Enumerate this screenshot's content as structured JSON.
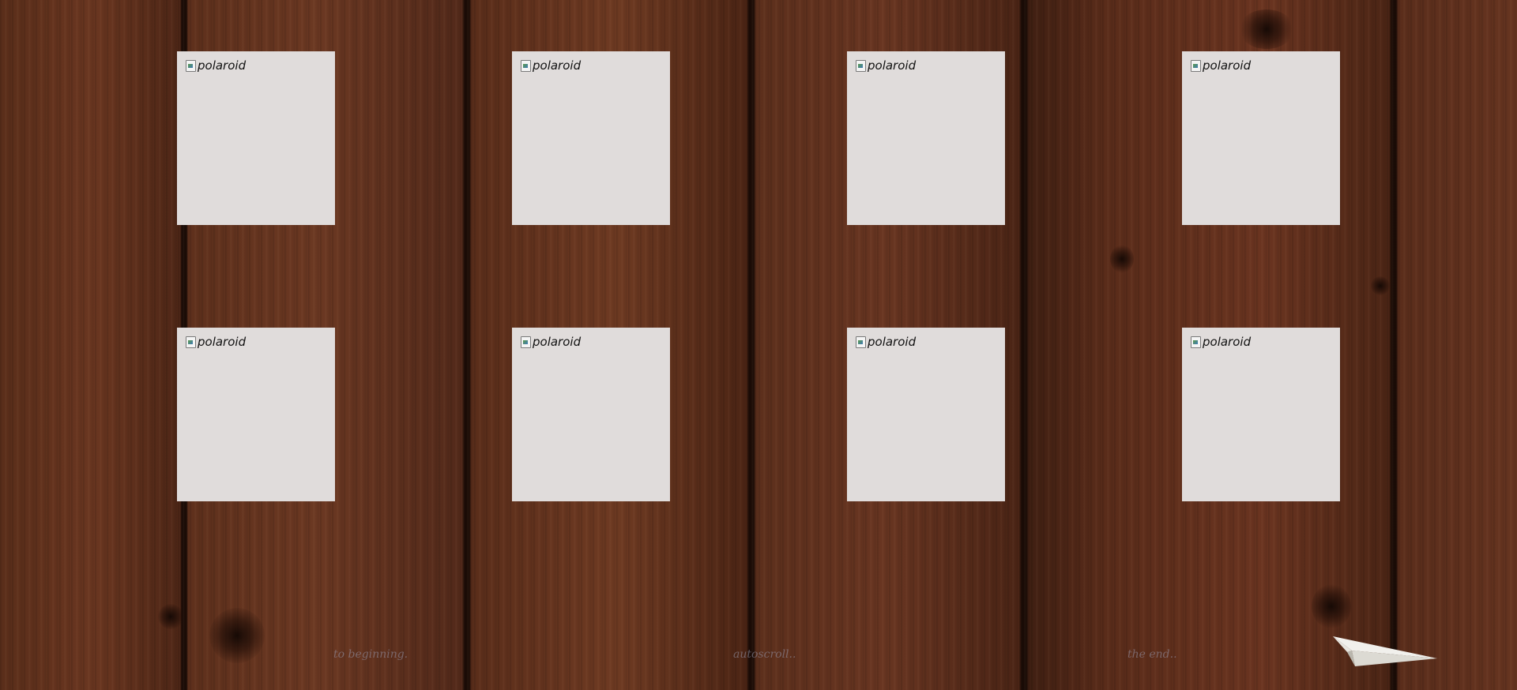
{
  "gallery": {
    "image_alt": "polaroid",
    "polaroids": [
      {
        "alt": "polaroid"
      },
      {
        "alt": "polaroid"
      },
      {
        "alt": "polaroid"
      },
      {
        "alt": "polaroid"
      },
      {
        "alt": "polaroid"
      },
      {
        "alt": "polaroid"
      },
      {
        "alt": "polaroid"
      },
      {
        "alt": "polaroid"
      }
    ]
  },
  "nav": {
    "to_beginning": "to beginning.",
    "autoscroll": "autoscroll..",
    "the_end": "the end.."
  },
  "icons": {
    "polaroid_image": "broken-image-icon",
    "plane": "paper-plane-icon"
  },
  "colors": {
    "polaroid_bg": "#e0dcdb",
    "nav_text": "#9696aa",
    "wood": "#4a2616"
  }
}
